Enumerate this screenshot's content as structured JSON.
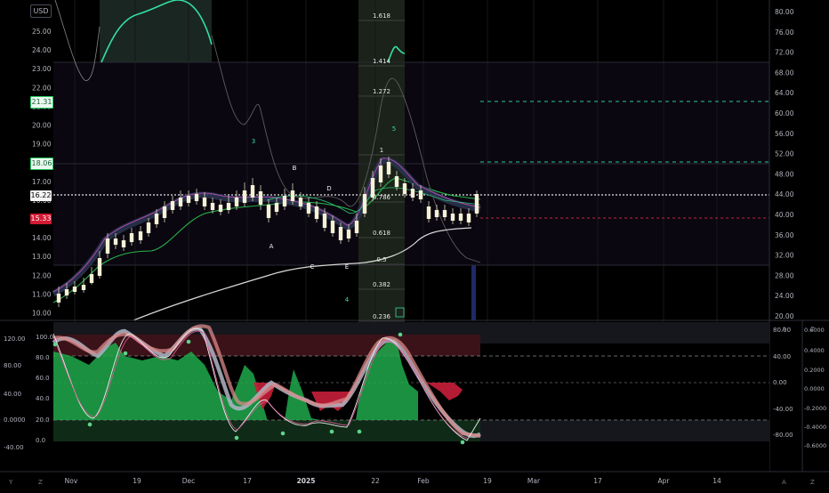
{
  "header": {
    "currency_label": "USD"
  },
  "colors": {
    "background": "#000000",
    "grid": "#15171c",
    "candle_up": "#f5f1d6",
    "candle_down": "#f5f1d6",
    "accent_green": "#38d9a9",
    "neon_green": "#22c55e",
    "red": "#ef4444",
    "price_tag_current": "#f5f5f5"
  },
  "price_axis_left": [
    "25.00",
    "24.00",
    "23.00",
    "22.00",
    "21.00",
    "20.00",
    "19.00",
    "18.00",
    "17.00",
    "16.00",
    "15.00",
    "14.00",
    "13.00",
    "12.00",
    "11.00",
    "10.00"
  ],
  "price_axis_right": [
    "80.00",
    "76.00",
    "72.00",
    "68.00",
    "64.00",
    "60.00",
    "56.00",
    "52.00",
    "48.00",
    "44.00",
    "40.00",
    "36.00",
    "32.00",
    "28.00",
    "24.00",
    "20.00"
  ],
  "price_tags": [
    {
      "value": "21.31",
      "kind": "green"
    },
    {
      "value": "18.06",
      "kind": "green"
    },
    {
      "value": "16.22",
      "kind": "current"
    },
    {
      "value": "15.33",
      "kind": "red"
    }
  ],
  "fib_levels": [
    "1.618",
    "1.414",
    "1.272",
    "1",
    "0.786",
    "0.618",
    "0.5",
    "0.382",
    "0.236"
  ],
  "wave_labels": [
    "3",
    "5",
    "B",
    "D",
    "A",
    "C",
    "E",
    "4"
  ],
  "osc_axis_left": [
    "120.00",
    "80.00",
    "40.00",
    "0.0000",
    "-40.00"
  ],
  "osc_axis_inner": [
    "100.0",
    "80.0",
    "60.0",
    "40.0",
    "20.0",
    "0.0"
  ],
  "osc_axis_right": [
    "80.00",
    "40.00",
    "0.00",
    "-40.00",
    "-80.00"
  ],
  "osc_axis_far_right": [
    "0.6000",
    "0.4000",
    "0.2000",
    "0.0000",
    "-0.2000",
    "-0.4000",
    "-0.6000"
  ],
  "time_axis": [
    "Nov",
    "19",
    "Dec",
    "17",
    "2025",
    "22",
    "Feb",
    "19",
    "Mar",
    "17",
    "Apr",
    "14"
  ],
  "corner_letters": {
    "y": "Y",
    "z1": "Z",
    "a1": "A",
    "z2": "Z",
    "a2": "A",
    "z3": "Z"
  }
}
